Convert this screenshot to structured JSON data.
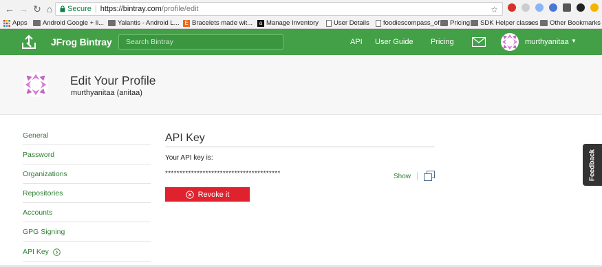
{
  "browser": {
    "secure_label": "Secure",
    "url_host": "https://bintray.com",
    "url_path": "/profile/edit"
  },
  "bookmarks": [
    {
      "label": "Apps",
      "icon": "apps-grid-icon"
    },
    {
      "label": "Android Google + li...",
      "icon": "folder-icon"
    },
    {
      "label": "Yalantis - Android L...",
      "icon": "folder-icon"
    },
    {
      "label": "Bracelets made wit...",
      "icon": "etsy-icon"
    },
    {
      "label": "Manage Inventory",
      "icon": "amazon-icon"
    },
    {
      "label": "User Details",
      "icon": "page-icon"
    },
    {
      "label": "foodiescompass_of...",
      "icon": "page-icon"
    },
    {
      "label": "Pricing",
      "icon": "folder-icon"
    },
    {
      "label": "SDK Helper classes",
      "icon": "folder-icon"
    },
    {
      "label": "»",
      "icon": ""
    },
    {
      "label": "Other Bookmarks",
      "icon": "folder-icon"
    }
  ],
  "header": {
    "brand": "JFrog Bintray",
    "search_placeholder": "Search Bintray",
    "links": [
      "API",
      "User Guide",
      "Pricing"
    ],
    "username": "murthyanitaa",
    "accent": "#43a047"
  },
  "profile": {
    "title": "Edit Your Profile",
    "subtitle": "murthyanitaa (anitaa)"
  },
  "sidebar": {
    "items": [
      "General",
      "Password",
      "Organizations",
      "Repositories",
      "Accounts",
      "GPG Signing",
      "API Key"
    ]
  },
  "api_key": {
    "title": "API Key",
    "label": "Your API key is:",
    "masked_key": "****************************************",
    "show_label": "Show",
    "revoke_label": "Revoke it",
    "revoke_color": "#e0222f"
  },
  "feedback_label": "Feedback"
}
